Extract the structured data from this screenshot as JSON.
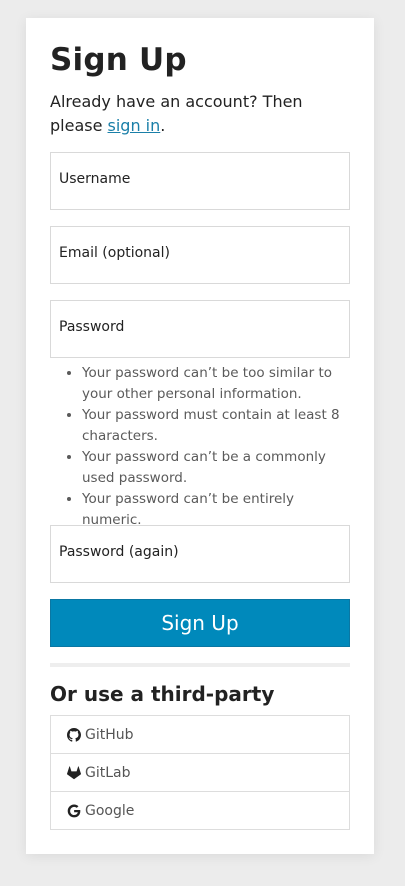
{
  "heading": "Sign Up",
  "intro": {
    "text_before": "Already have an account? Then please ",
    "link": "sign in",
    "text_after": "."
  },
  "fields": {
    "username": "Username",
    "email": "Email (optional)",
    "password": "Password",
    "password_again": "Password (again)"
  },
  "password_help": [
    "Your password can’t be too similar to your other personal information.",
    "Your password must contain at least 8 characters.",
    "Your password can’t be a commonly used password.",
    "Your password can’t be entirely numeric."
  ],
  "submit_label": "Sign Up",
  "third_party": {
    "heading": "Or use a third-party",
    "providers": [
      {
        "label": "GitHub",
        "icon": "github-icon"
      },
      {
        "label": "GitLab",
        "icon": "gitlab-icon"
      },
      {
        "label": "Google",
        "icon": "google-icon"
      }
    ]
  },
  "colors": {
    "accent": "#0089bb",
    "link": "#1a7fa8",
    "background": "#ececec"
  }
}
